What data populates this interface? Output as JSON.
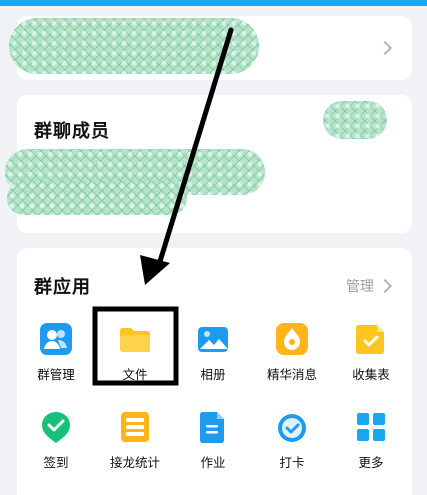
{
  "members_section": {
    "title": "群聊成员"
  },
  "apps_section": {
    "title": "群应用",
    "manage_label": "管理",
    "apps": [
      {
        "label": "群管理",
        "icon": "group-admin-icon",
        "color": "#1e9bf0"
      },
      {
        "label": "文件",
        "icon": "folder-icon",
        "color": "#ffc41f"
      },
      {
        "label": "相册",
        "icon": "photo-album-icon",
        "color": "#1e9bf0"
      },
      {
        "label": "精华消息",
        "icon": "essence-message-icon",
        "color": "#ffb41a"
      },
      {
        "label": "收集表",
        "icon": "collection-form-icon",
        "color": "#ffc41f"
      },
      {
        "label": "签到",
        "icon": "checkin-icon",
        "color": "#16c27a"
      },
      {
        "label": "接龙统计",
        "icon": "relay-stats-icon",
        "color": "#ffb41a"
      },
      {
        "label": "作业",
        "icon": "homework-icon",
        "color": "#1e9bf0"
      },
      {
        "label": "打卡",
        "icon": "clock-in-icon",
        "color": "#1e9bf0"
      },
      {
        "label": "更多",
        "icon": "more-grid-icon",
        "color": "#19a7ee"
      }
    ]
  }
}
